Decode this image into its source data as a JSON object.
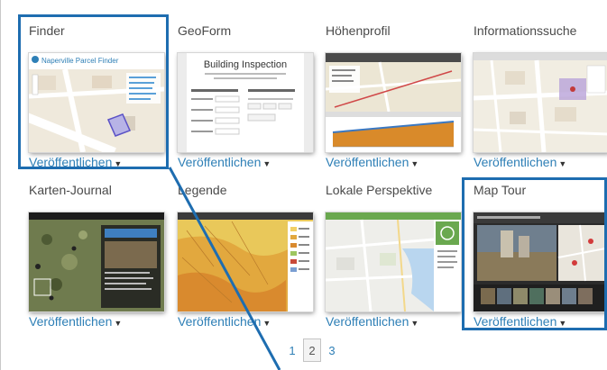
{
  "gallery": {
    "tiles": [
      {
        "title": "Finder",
        "publish_label": "Veröffentlichen",
        "thumb_text": "Naperville Parcel Finder"
      },
      {
        "title": "GeoForm",
        "publish_label": "Veröffentlichen",
        "thumb_text": "Building Inspection"
      },
      {
        "title": "Höhenprofil",
        "publish_label": "Veröffentlichen"
      },
      {
        "title": "Informationssuche",
        "publish_label": "Veröffentlichen"
      },
      {
        "title": "Karten-Journal",
        "publish_label": "Veröffentlichen"
      },
      {
        "title": "Legende",
        "publish_label": "Veröffentlichen"
      },
      {
        "title": "Lokale Perspektive",
        "publish_label": "Veröffentlichen"
      },
      {
        "title": "Map Tour",
        "publish_label": "Veröffentlichen"
      }
    ],
    "dropdown_icon": "caret-down-icon"
  },
  "pagination": {
    "pages": [
      "1",
      "2",
      "3"
    ],
    "current": "2"
  },
  "colors": {
    "accent": "#2e7fb6",
    "highlight": "#1e6db0",
    "title_text": "#4a4a4a"
  }
}
